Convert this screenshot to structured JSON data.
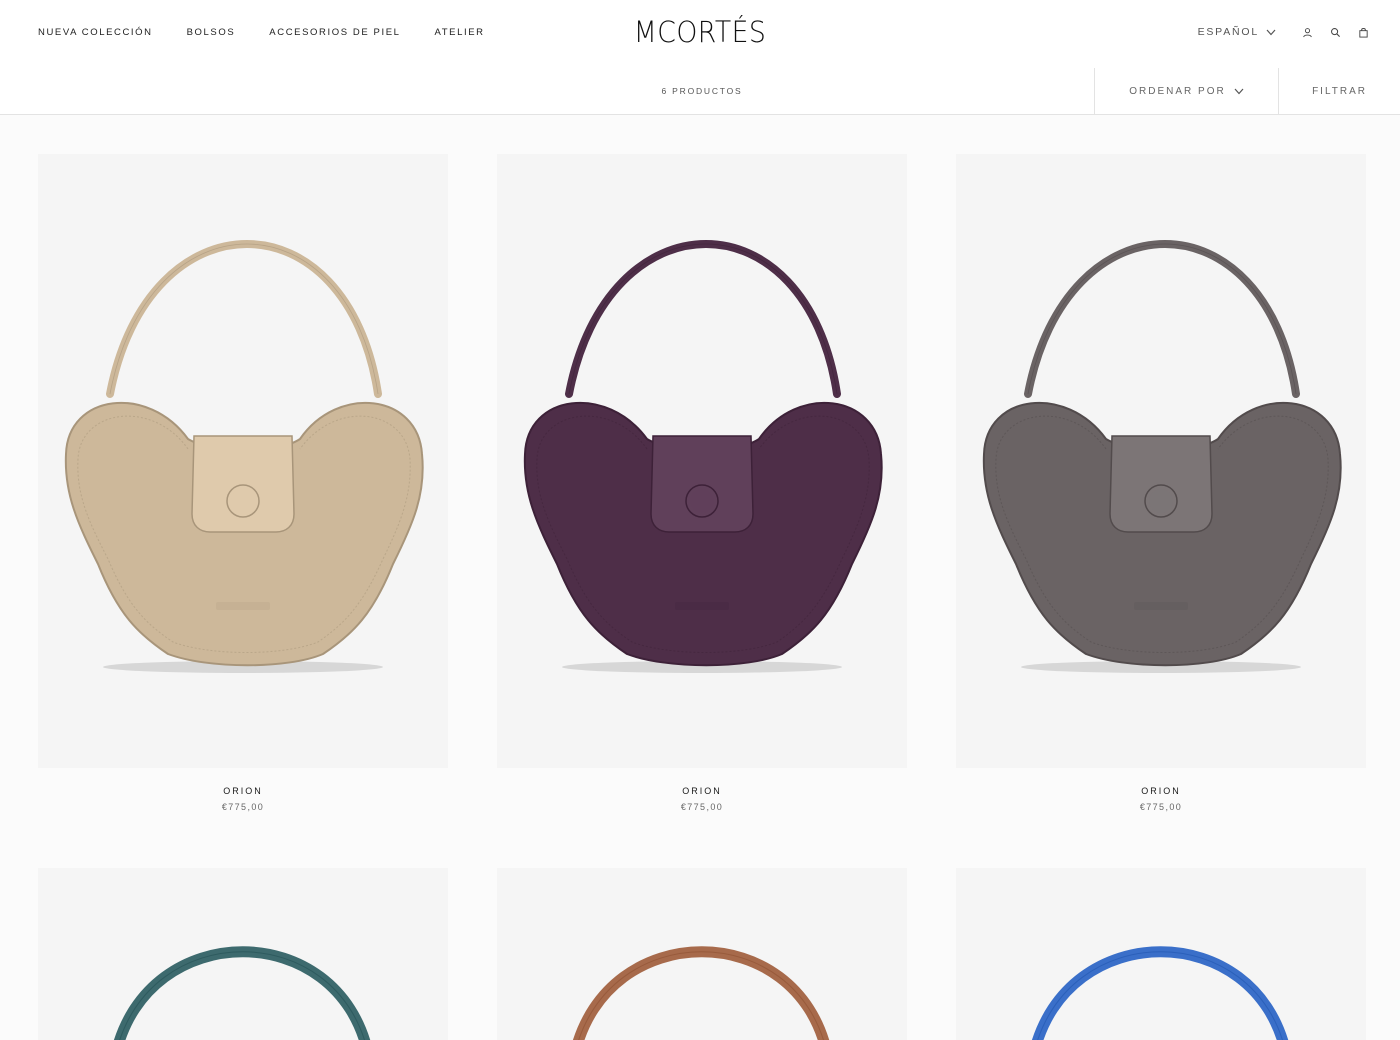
{
  "nav": {
    "items": [
      "NUEVA COLECCIÓN",
      "BOLSOS",
      "ACCESORIOS DE PIEL",
      "ATELIER"
    ]
  },
  "brand": {
    "logo": "MCORTÉS"
  },
  "tools": {
    "language": "ESPAÑOL"
  },
  "toolbar": {
    "count": "6 PRODUCTOS",
    "sort_label": "ORDENAR POR",
    "filter_label": "FILTRAR"
  },
  "products": [
    {
      "name": "ORION",
      "price": "€775,00",
      "color": "#cdb89a",
      "stroke": "#a8957a"
    },
    {
      "name": "ORION",
      "price": "€775,00",
      "color": "#4e2e48",
      "stroke": "#3d2138"
    },
    {
      "name": "ORION",
      "price": "€775,00",
      "color": "#6a6364",
      "stroke": "#524b4c"
    },
    {
      "color": "#3d6a6e"
    },
    {
      "color": "#a76a4b"
    },
    {
      "color": "#3a6fc9"
    }
  ]
}
